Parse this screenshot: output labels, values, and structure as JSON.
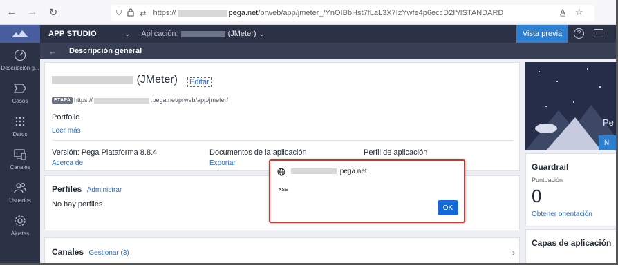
{
  "browser": {
    "url_prefix": "https://",
    "url_domain": "pega.net",
    "url_path": "/prweb/app/jmeter_/YnOIBbHst7fLaL3X7IzYwfe4p6eccD2I*/!STANDARD"
  },
  "header": {
    "studio_title": "APP STUDIO",
    "app_label": "Aplicación:",
    "app_name": "(JMeter)",
    "preview_label": "Vista previa",
    "help_glyph": "?"
  },
  "subheader": {
    "back_glyph": "←",
    "title": "Descripción general"
  },
  "rail": {
    "items": [
      {
        "label": "Descripción g...",
        "icon": "gauge-icon"
      },
      {
        "label": "Casos",
        "icon": "case-icon"
      },
      {
        "label": "Datos",
        "icon": "data-grid-icon"
      },
      {
        "label": "Canales",
        "icon": "channels-icon"
      },
      {
        "label": "Usuarios",
        "icon": "users-icon"
      },
      {
        "label": "Ajustes",
        "icon": "gear-icon"
      }
    ]
  },
  "overview": {
    "title_suffix": "(JMeter)",
    "edit_label": "Editar",
    "stage_badge": "ETAPA",
    "stage_url_prefix": "https://",
    "stage_url_suffix": ".pega.net/prweb/app/jmeter/",
    "portfolio": "Portfolio",
    "read_more": "Leer más",
    "version_label": "Versión: Pega Plataforma 8.8.4",
    "version_link": "Acerca de",
    "docs_label": "Documentos de la aplicación",
    "docs_link": "Exportar",
    "profile_label": "Perfil de aplicación"
  },
  "profiles": {
    "title": "Perfiles",
    "link": "Administrar",
    "empty_text": "No hay perfiles"
  },
  "channels": {
    "title": "Canales",
    "link": "Gestionar (3)",
    "chevron": "›"
  },
  "right": {
    "hero_text": "Pe",
    "hero_button": "N",
    "guardrail_title": "Guardrail",
    "guardrail_sub": "Puntuación",
    "guardrail_score": "0",
    "guardrail_link": "Obtener orientación",
    "layers_title": "Capas de aplicación"
  },
  "dialog": {
    "origin_suffix": ".pega.net",
    "message": "xss",
    "ok_label": "OK"
  },
  "colors": {
    "header_bg": "#2b3245",
    "accent": "#2e7fd0",
    "dialog_border": "#d9302b"
  }
}
